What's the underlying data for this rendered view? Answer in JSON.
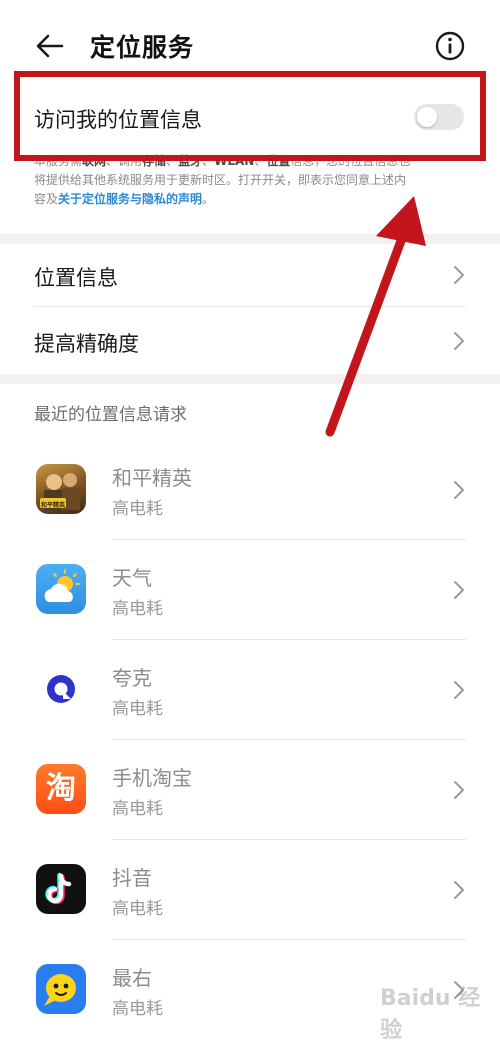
{
  "header": {
    "title": "定位服务"
  },
  "location_access": {
    "label": "访问我的位置信息",
    "enabled": false,
    "desc_line1_pre": "本服务需",
    "desc_b1": "联网",
    "desc_mid1": "、调用",
    "desc_b2": "存储",
    "desc_mid2": "、",
    "desc_b3": "蓝牙",
    "desc_mid3": "、",
    "desc_b4": "WLAN",
    "desc_mid4": "、",
    "desc_b5": "位置",
    "desc_line1_post": "信息，您的位置信息也",
    "desc_line2": "将提供给其他系统服务用于更新时区。打开开关，即表示您同意上述内",
    "desc_line3_pre": "容及",
    "desc_link": "关于定位服务与隐私的声明",
    "desc_line3_post": "。"
  },
  "menu": [
    {
      "label": "位置信息"
    },
    {
      "label": "提高精确度"
    }
  ],
  "recent": {
    "title": "最近的位置信息请求",
    "apps": [
      {
        "name": "和平精英",
        "usage": "高电耗",
        "icon": "pubg-icon"
      },
      {
        "name": "天气",
        "usage": "高电耗",
        "icon": "weather-icon"
      },
      {
        "name": "夸克",
        "usage": "高电耗",
        "icon": "quark-icon"
      },
      {
        "name": "手机淘宝",
        "usage": "高电耗",
        "icon": "taobao-icon"
      },
      {
        "name": "抖音",
        "usage": "高电耗",
        "icon": "douyin-icon"
      },
      {
        "name": "最右",
        "usage": "高电耗",
        "icon": "zuiyou-icon"
      }
    ]
  },
  "icons": {
    "taobao_glyph": "淘",
    "pubg_badge": "和平精英"
  },
  "colors": {
    "annotation_red": "#c3161c",
    "link_blue": "#2d8bd6",
    "taobao_orange": "#ff5a1f",
    "quark_blue": "#2f33c9",
    "weather_blue": "#3fa0ee",
    "zuiyou_yellow": "#ffd31a"
  },
  "watermark": "Baidu 经验"
}
